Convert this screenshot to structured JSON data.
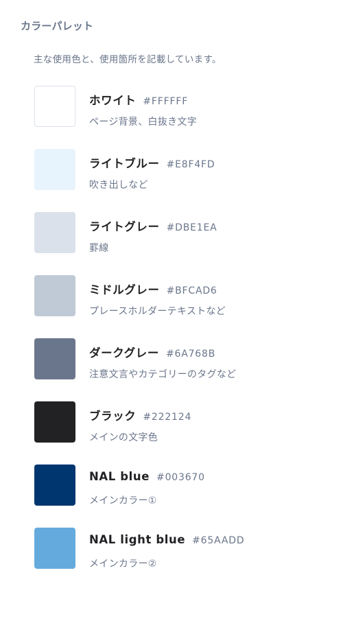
{
  "section_title": "カラーパレット",
  "intro": "主な使用色と、使用箇所を記載しています。",
  "colors": [
    {
      "name": "ホワイト",
      "hex": "#FFFFFF",
      "usage": "ページ背景、白抜き文字",
      "swatch": "#FFFFFF",
      "outlined": true
    },
    {
      "name": "ライトブルー",
      "hex": "#E8F4FD",
      "usage": "吹き出しなど",
      "swatch": "#E8F4FD",
      "outlined": false
    },
    {
      "name": "ライトグレー",
      "hex": "#DBE1EA",
      "usage": "罫線",
      "swatch": "#DBE1EA",
      "outlined": false
    },
    {
      "name": "ミドルグレー",
      "hex": "#BFCAD6",
      "usage": "プレースホルダーテキストなど",
      "swatch": "#BFCAD6",
      "outlined": false
    },
    {
      "name": "ダークグレー",
      "hex": "#6A768B",
      "usage": "注意文言やカテゴリーのタグなど",
      "swatch": "#6A768B",
      "outlined": false
    },
    {
      "name": "ブラック",
      "hex": "#222124",
      "usage": "メインの文字色",
      "swatch": "#222124",
      "outlined": false
    },
    {
      "name": "NAL blue",
      "hex": "#003670",
      "usage": "メインカラー①",
      "swatch": "#003670",
      "outlined": false
    },
    {
      "name": "NAL light blue",
      "hex": "#65AADD",
      "usage": "メインカラー②",
      "swatch": "#65AADD",
      "outlined": false
    }
  ]
}
